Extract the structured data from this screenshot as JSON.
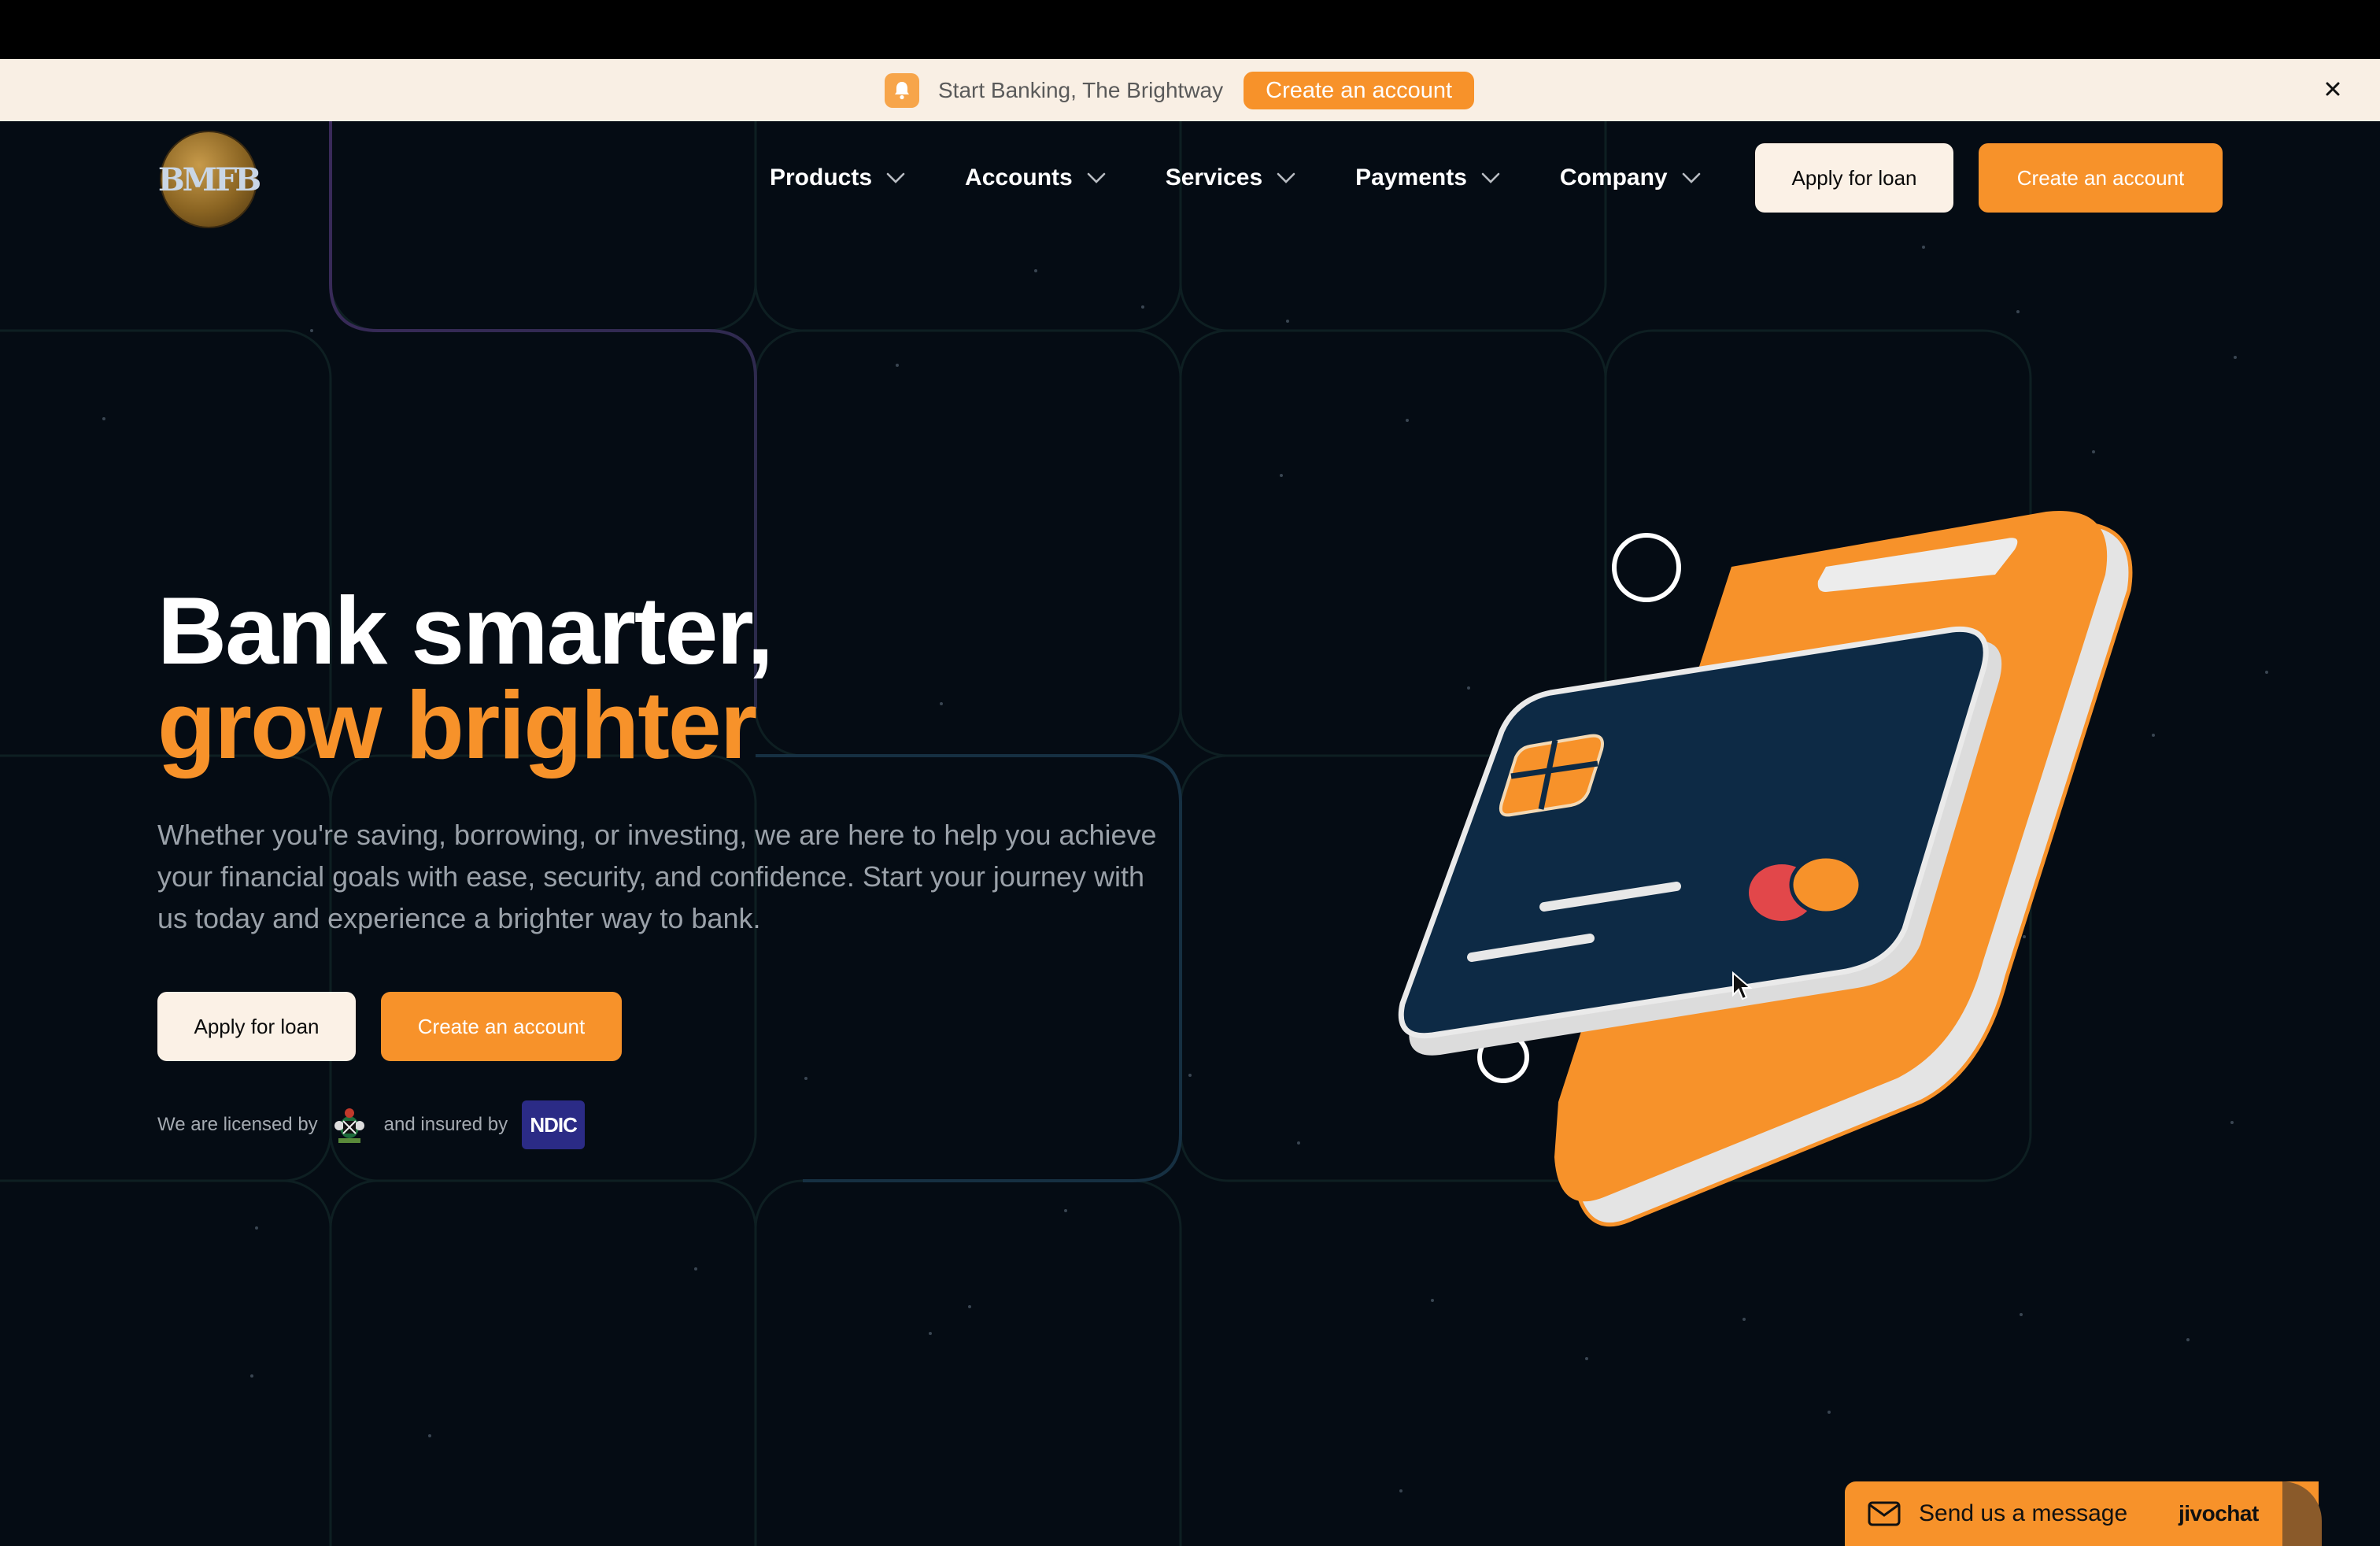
{
  "banner": {
    "text": "Start Banking, The Brightway",
    "cta_label": "Create an account",
    "icon": "bell-icon",
    "close_icon": "close-icon"
  },
  "header": {
    "logo_text": "BMFB",
    "nav": [
      {
        "label": "Products",
        "icon": "chevron-down-icon"
      },
      {
        "label": "Accounts",
        "icon": "chevron-down-icon"
      },
      {
        "label": "Services",
        "icon": "chevron-down-icon"
      },
      {
        "label": "Payments",
        "icon": "chevron-down-icon"
      },
      {
        "label": "Company",
        "icon": "chevron-down-icon"
      }
    ],
    "apply_label": "Apply for loan",
    "create_label": "Create an account"
  },
  "hero": {
    "title_line1": "Bank smarter,",
    "title_line2": "grow brighter",
    "subtitle": "Whether you're saving, borrowing, or investing, we are here to help you achieve your financial goals with ease, security, and confidence. Start your journey with us today and experience a brighter way to bank.",
    "apply_label": "Apply for loan",
    "create_label": "Create an account",
    "license_prefix": "We are licensed by",
    "insured_text": "and insured by",
    "insurer_logo_text": "NDIC",
    "illustration": "phone-and-credit-card-illustration"
  },
  "chat": {
    "label": "Send us a message",
    "brand": "jivochat",
    "icon": "envelope-icon"
  },
  "colors": {
    "background": "#050c14",
    "accent": "#f7922a",
    "banner_bg": "#f9efe4",
    "light_button": "#fbf1e6",
    "card_navy": "#0d2a45"
  }
}
